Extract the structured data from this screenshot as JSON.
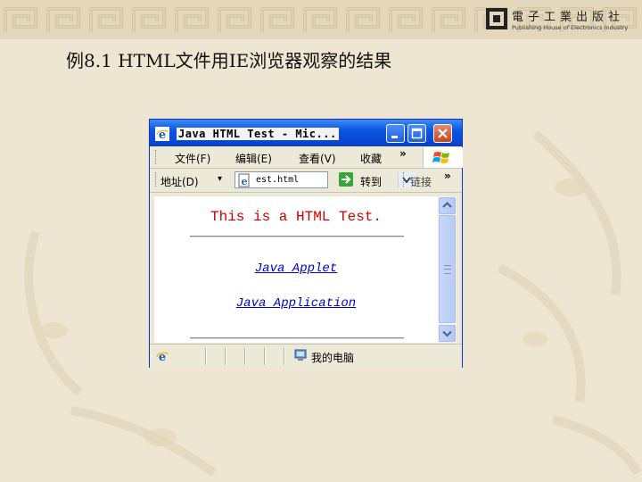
{
  "publisher": {
    "name_cn": "電子工業出版社",
    "name_en": "Publishing House of Electronics Industry"
  },
  "slide": {
    "title": "例8.1 HTML文件用IE浏览器观察的结果"
  },
  "window": {
    "title": "Java HTML Test - Mic...",
    "menu": [
      "文件(F)",
      "编辑(E)",
      "查看(V)",
      "收藏"
    ],
    "menu_more": "»",
    "address_label": "地址(D)",
    "address_dropdown": "▾",
    "address_value": "est.html",
    "go_label": "转到",
    "links_label": "链接",
    "links_more": "»",
    "status_zone": "我的电脑"
  },
  "page": {
    "heading": "This is a HTML Test.",
    "links": [
      "Java Applet",
      "Java Application"
    ]
  },
  "colors": {
    "titlebar": "#0a57e0",
    "heading": "#cc0000",
    "link": "#0000cc",
    "chrome": "#ece9d8"
  },
  "icons": {
    "window_icon": "ie-icon",
    "minimize": "minimize-icon",
    "maximize": "maximize-icon",
    "close": "close-icon",
    "windows_logo": "windows-logo",
    "go": "go-arrow-icon",
    "zone": "my-computer-icon"
  }
}
